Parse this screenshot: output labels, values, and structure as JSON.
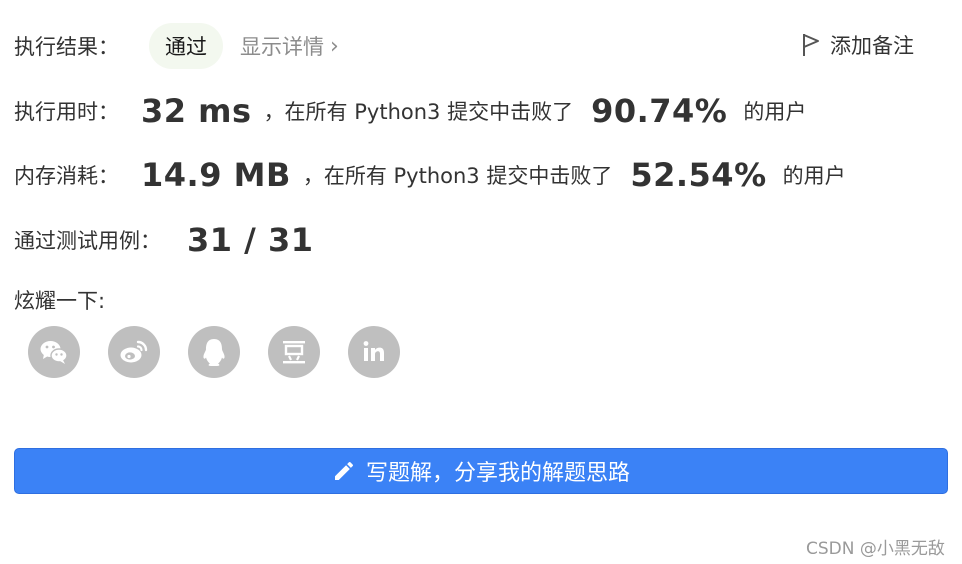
{
  "result": {
    "label": "执行结果：",
    "status": "通过",
    "details_link": "显示详情",
    "details_chevron": "›",
    "add_note": "添加备注"
  },
  "runtime": {
    "label": "执行用时：",
    "value": "32 ms",
    "text": "，在所有 Python3 提交中击败了",
    "percent": "90.74%",
    "suffix": "的用户"
  },
  "memory": {
    "label": "内存消耗：",
    "value": "14.9 MB",
    "text": "，在所有 Python3 提交中击败了",
    "percent": "52.54%",
    "suffix": "的用户"
  },
  "tests": {
    "label": "通过测试用例：",
    "value": "31 / 31"
  },
  "share": {
    "label": "炫耀一下:",
    "icons": [
      "wechat-icon",
      "weibo-icon",
      "qq-icon",
      "douban-icon",
      "linkedin-icon"
    ]
  },
  "solution_button": {
    "label": "写题解，分享我的解题思路"
  },
  "watermark": "CSDN @小黑无敌",
  "colors": {
    "pass_pill_bg": "#f3f8ef",
    "primary_button": "#3b82f6",
    "share_icon_bg": "#bfbfbf"
  }
}
